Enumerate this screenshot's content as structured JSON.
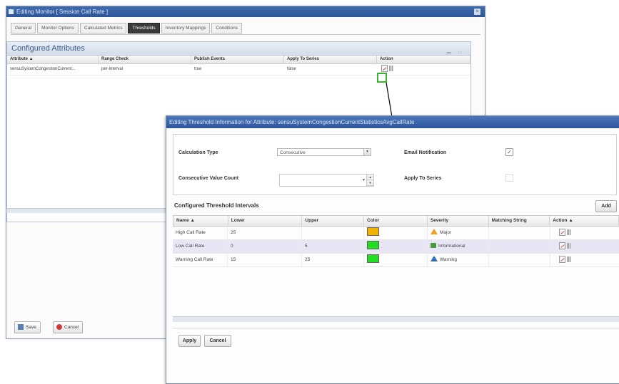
{
  "back_window": {
    "title": "Editing Monitor [ Session Call Rate ]",
    "tabs": [
      "General",
      "Monitor Options",
      "Calculated Metrics",
      "Thresholds",
      "Inventory Mappings",
      "Conditions"
    ],
    "active_tab": "Thresholds",
    "panel_title": "Configured Attributes",
    "columns": [
      "Attribute ▲",
      "Range Check",
      "Publish Events",
      "Apply To Series",
      "Action"
    ],
    "row": {
      "attribute": "sensuSystemCongestionCurrent...",
      "range_check": "per-interval",
      "publish_events": "true",
      "apply_to_series": "false"
    },
    "save_label": "Save",
    "cancel_label": "Cancel"
  },
  "dialog": {
    "title": "Editing Threshold Information for Attribute: sensuSystemCongestionCurrentStatisticsAvgCallRate",
    "calc_type_label": "Calculation Type",
    "calc_type_value": "Consecutive",
    "consec_label": "Consecutive Value Count",
    "email_label": "Email Notification",
    "email_checked": "✓",
    "apply_series_label": "Apply To Series",
    "section_title": "Configured Threshold Intervals",
    "add_label": "Add",
    "columns": [
      "Name ▲",
      "Lower",
      "Upper",
      "Color",
      "Severity",
      "Matching String",
      "Action ▲"
    ],
    "rows": [
      {
        "name": "High Call Rate",
        "lower": "25",
        "upper": "",
        "color": "#f0b400",
        "severity": "Major",
        "sev_icon": "major-icon",
        "matching": ""
      },
      {
        "name": "Low Call Rate",
        "lower": "0",
        "upper": "5",
        "color": "#22dd22",
        "severity": "Informational",
        "sev_icon": "info-icon",
        "matching": ""
      },
      {
        "name": "Warning Call Rate",
        "lower": "15",
        "upper": "25",
        "color": "#22dd22",
        "severity": "Warning",
        "sev_icon": "warning-icon",
        "matching": ""
      }
    ],
    "apply_label": "Apply",
    "cancel_label": "Cancel"
  },
  "colors": {
    "titlebar": "#2c5596",
    "highlight": "#3db133",
    "selected_row": "#e8e6f5"
  }
}
